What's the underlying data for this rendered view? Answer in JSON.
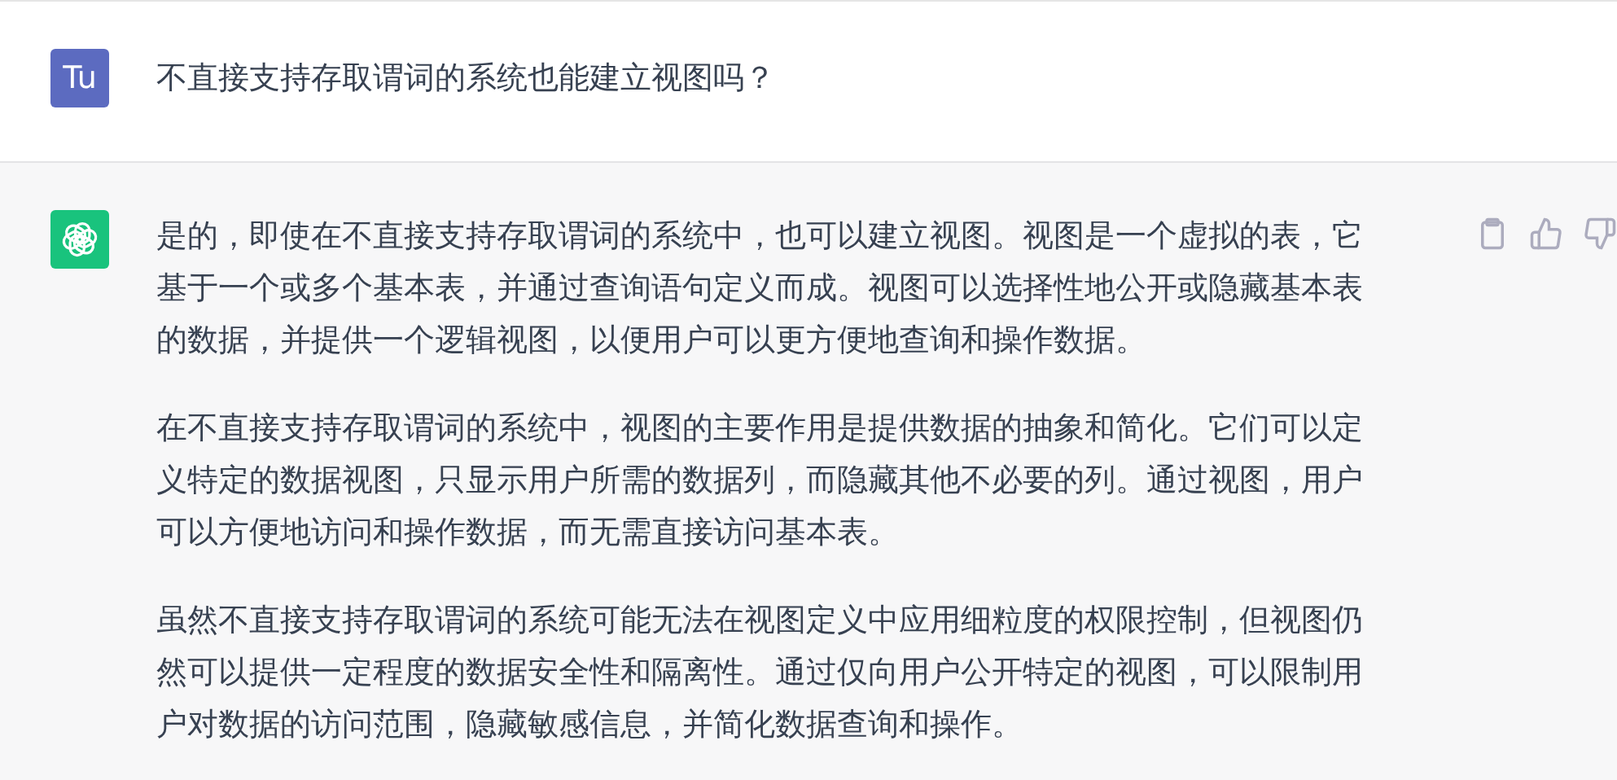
{
  "messages": [
    {
      "kind": "user",
      "avatar": "Tu",
      "paragraphs": [
        "不直接支持存取谓词的系统也能建立视图吗？"
      ]
    },
    {
      "kind": "assistant",
      "paragraphs": [
        "是的，即使在不直接支持存取谓词的系统中，也可以建立视图。视图是一个虚拟的表，它基于一个或多个基本表，并通过查询语句定义而成。视图可以选择性地公开或隐藏基本表的数据，并提供一个逻辑视图，以便用户可以更方便地查询和操作数据。",
        "在不直接支持存取谓词的系统中，视图的主要作用是提供数据的抽象和简化。它们可以定义特定的数据视图，只显示用户所需的数据列，而隐藏其他不必要的列。通过视图，用户可以方便地访问和操作数据，而无需直接访问基本表。",
        "虽然不直接支持存取谓词的系统可能无法在视图定义中应用细粒度的权限控制，但视图仍然可以提供一定程度的数据安全性和隔离性。通过仅向用户公开特定的视图，可以限制用户对数据的访问范围，隐藏敏感信息，并简化数据查询和操作。"
      ]
    }
  ]
}
